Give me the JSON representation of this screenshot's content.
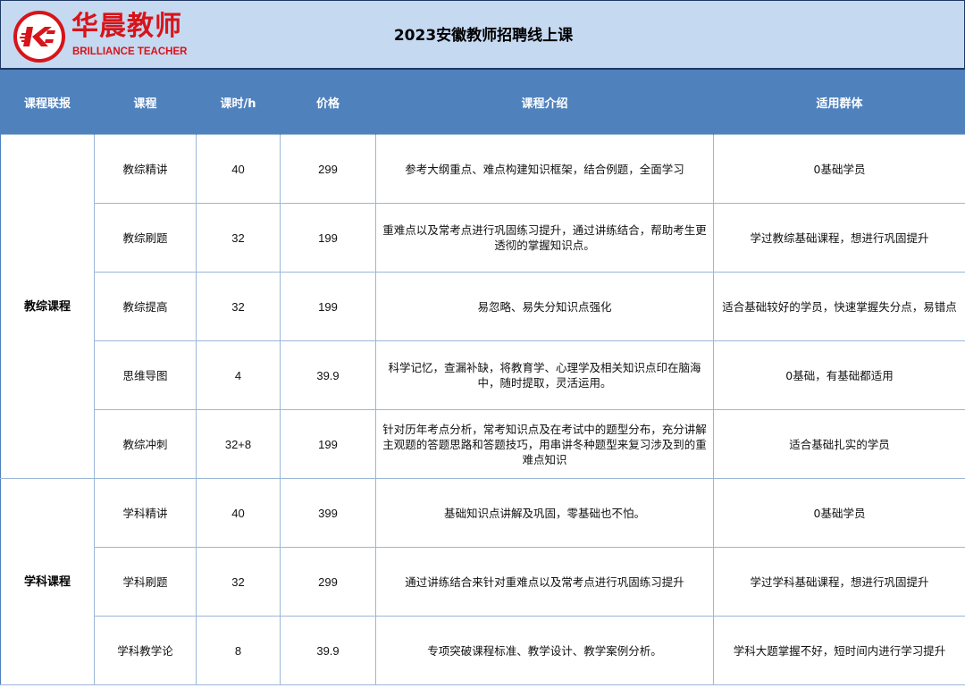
{
  "header": {
    "brand_cn": "华晨教师",
    "brand_en": "BRILLIANCE TEACHER",
    "title": "2023安徽教师招聘线上课",
    "logo_color": "#d7141a",
    "background": "#c5d9f1"
  },
  "table": {
    "header_color": "#4f81bd",
    "columns": [
      "课程联报",
      "课程",
      "课时/h",
      "价格",
      "课程介绍",
      "适用群体"
    ],
    "groups": [
      {
        "name": "教综课程",
        "rows": [
          {
            "course": "教综精讲",
            "hours": "40",
            "price": "299",
            "intro": "参考大纲重点、难点构建知识框架，结合例题，全面学习",
            "audience": "0基础学员"
          },
          {
            "course": "教综刷题",
            "hours": "32",
            "price": "199",
            "intro": "重难点以及常考点进行巩固练习提升，通过讲练结合，帮助考生更透彻的掌握知识点。",
            "audience": "学过教综基础课程，想进行巩固提升"
          },
          {
            "course": "教综提高",
            "hours": "32",
            "price": "199",
            "intro": "易忽略、易失分知识点强化",
            "audience": "适合基础较好的学员，快速掌握失分点，易错点"
          },
          {
            "course": "思维导图",
            "hours": "4",
            "price": "39.9",
            "intro": "科学记忆，查漏补缺，将教育学、心理学及相关知识点印在脑海中，随时提取，灵活运用。",
            "audience": "0基础，有基础都适用"
          },
          {
            "course": "教综冲刺",
            "hours": "32+8",
            "price": "199",
            "intro": "针对历年考点分析，常考知识点及在考试中的题型分布，充分讲解主观题的答题思路和答题技巧，用串讲冬种题型来复习涉及到的重难点知识",
            "audience": "适合基础扎实的学员"
          }
        ]
      },
      {
        "name": "学科课程",
        "rows": [
          {
            "course": "学科精讲",
            "hours": "40",
            "price": "399",
            "intro": "基础知识点讲解及巩固，零基础也不怕。",
            "audience": "0基础学员"
          },
          {
            "course": "学科刷题",
            "hours": "32",
            "price": "299",
            "intro": "通过讲练结合来针对重难点以及常考点进行巩固练习提升",
            "audience": "学过学科基础课程，想进行巩固提升"
          },
          {
            "course": "学科教学论",
            "hours": "8",
            "price": "39.9",
            "intro": "专项突破课程标准、教学设计、教学案例分析。",
            "audience": "学科大题掌握不好，短时间内进行学习提升"
          }
        ]
      }
    ]
  }
}
